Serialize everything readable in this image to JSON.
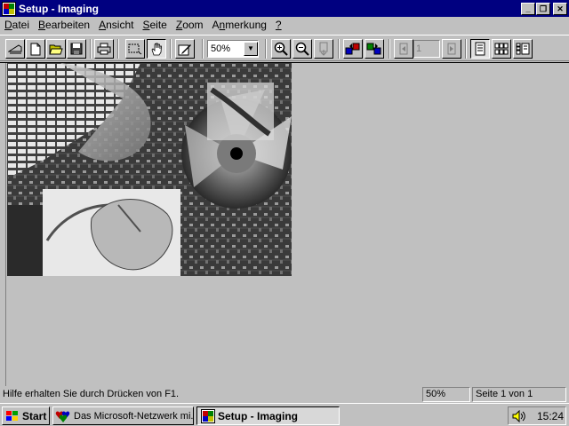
{
  "window": {
    "title": "Setup - Imaging"
  },
  "titlebar": {
    "minimize": "_",
    "restore": "❐",
    "close": "✕"
  },
  "menu": [
    {
      "label": "Datei",
      "ul": "D",
      "rest": "atei"
    },
    {
      "label": "Bearbeiten",
      "ul": "B",
      "rest": "earbeiten"
    },
    {
      "label": "Ansicht",
      "ul": "A",
      "rest": "nsicht"
    },
    {
      "label": "Seite",
      "ul": "S",
      "rest": "eite"
    },
    {
      "label": "Zoom",
      "ul": "Z",
      "rest": "oom"
    },
    {
      "label": "Anmerkung",
      "ul": "n",
      "pre": "A",
      "rest": "merkung"
    },
    {
      "label": "?",
      "ul": "?",
      "rest": ""
    }
  ],
  "toolbar": {
    "zoom": {
      "value": "50%"
    },
    "page_number": "1"
  },
  "status": {
    "help": "Hilfe erhalten Sie durch Drücken von F1.",
    "zoom": "50%",
    "page": "Seite 1 von 1"
  },
  "taskbar": {
    "start": "Start",
    "tasks": [
      {
        "label": "Das Microsoft-Netzwerk mi..."
      },
      {
        "label": "Setup - Imaging"
      }
    ],
    "clock": "15:24"
  },
  "icons": {
    "app": "imaging-icon",
    "msn": "msn-icon",
    "speaker": "speaker-icon"
  },
  "colors": {
    "titlebar": "#000080",
    "face": "#c0c0c0"
  }
}
